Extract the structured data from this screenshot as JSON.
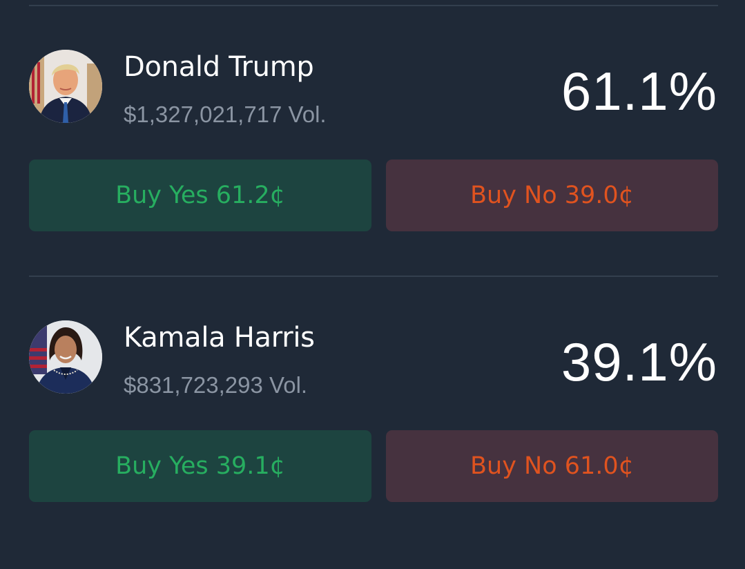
{
  "colors": {
    "background": "#1f2937",
    "yes_button_bg": "#1d4440",
    "yes_text": "#27ae60",
    "no_button_bg": "#46323f",
    "no_text": "#e0531f",
    "volume_text": "#8b95a3"
  },
  "markets": [
    {
      "name": "Donald Trump",
      "volume": "$1,327,021,717 Vol.",
      "probability": "61.1%",
      "avatar": "candidate-portrait",
      "buy_yes": "Buy Yes 61.2¢",
      "buy_no": "Buy No 39.0¢"
    },
    {
      "name": "Kamala Harris",
      "volume": "$831,723,293 Vol.",
      "probability": "39.1%",
      "avatar": "candidate-portrait",
      "buy_yes": "Buy Yes 39.1¢",
      "buy_no": "Buy No 61.0¢"
    }
  ]
}
